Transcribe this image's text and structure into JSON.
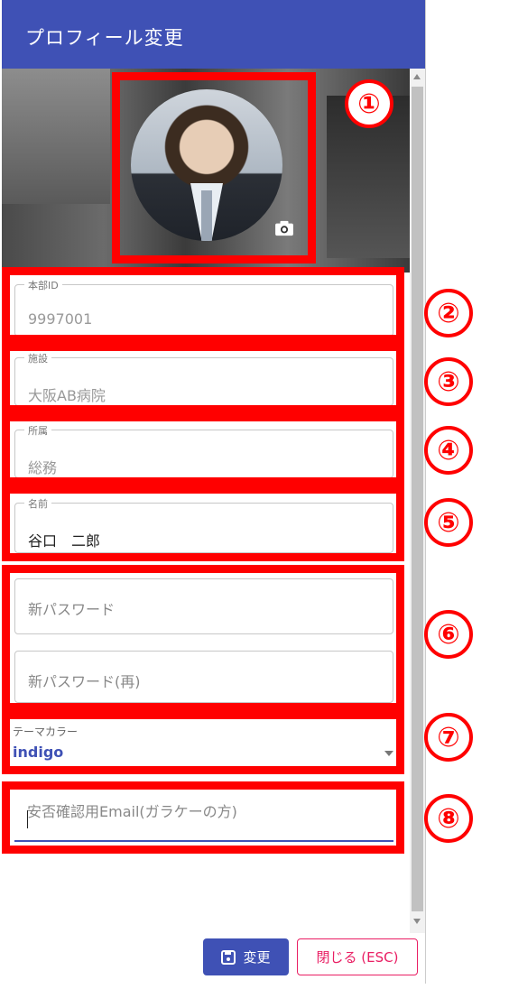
{
  "dialog": {
    "title": "プロフィール変更",
    "fields": [
      {
        "label": "本部ID",
        "value": "9997001"
      },
      {
        "label": "施設",
        "value": "大阪AB病院"
      },
      {
        "label": "所属",
        "value": "総務"
      },
      {
        "label": "名前",
        "value": "谷口　二郎"
      }
    ],
    "password_placeholder": "新パスワード",
    "password_confirm_placeholder": "新パスワード(再)",
    "theme": {
      "label": "テーマカラー",
      "value": "indigo"
    },
    "email_placeholder": "安否確認用Email(ガラケーの方)",
    "save_button": "変更",
    "close_button": "閉じる (ESC)"
  },
  "markers": [
    "①",
    "②",
    "③",
    "④",
    "⑤",
    "⑥",
    "⑦",
    "⑧"
  ],
  "colors": {
    "primary": "#3f51b5",
    "accent": "#e91e63",
    "annotation": "#ff0000"
  }
}
